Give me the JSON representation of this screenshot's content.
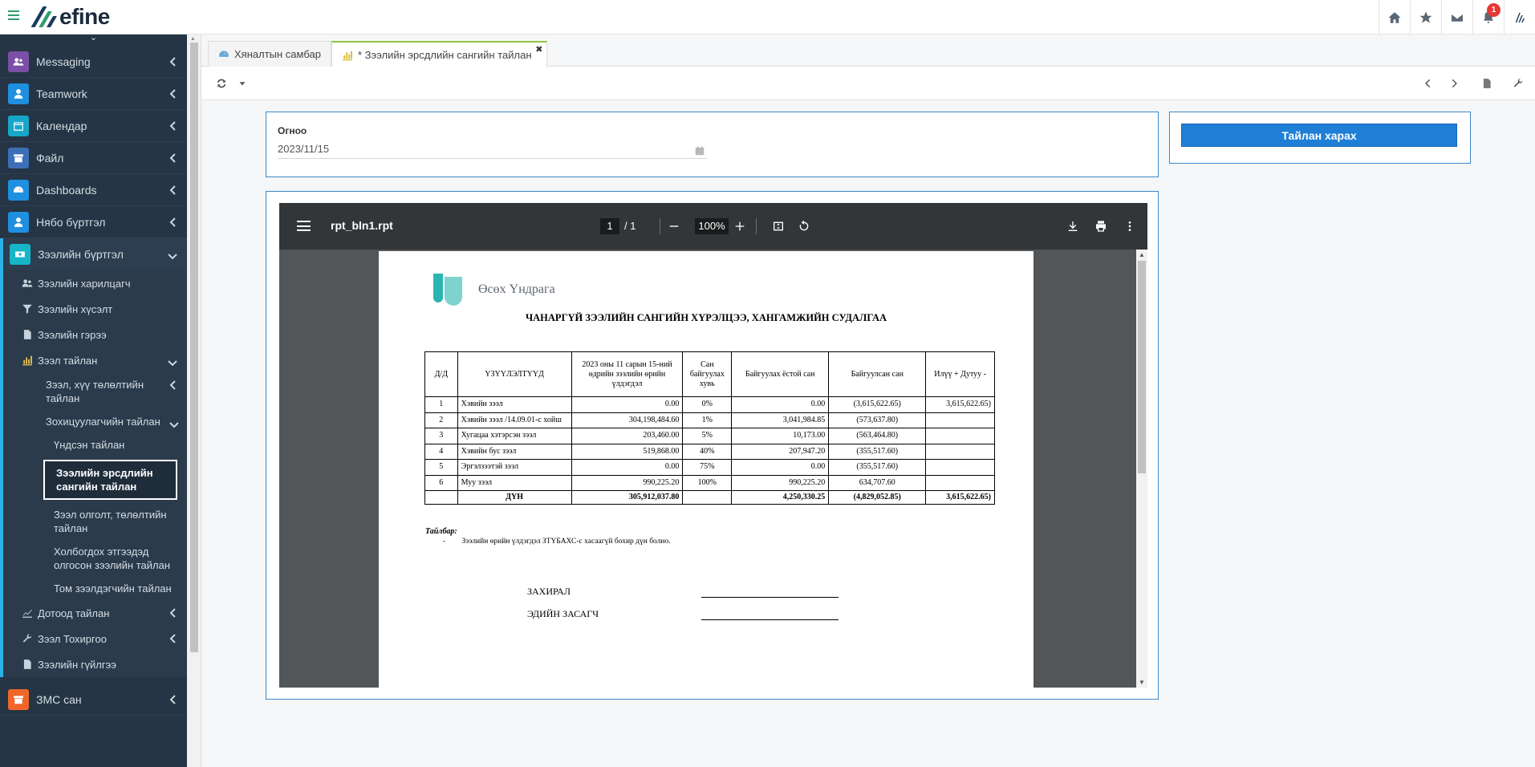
{
  "app": {
    "logo_text": "efine",
    "notification_count": "1"
  },
  "sidebar": {
    "items": [
      {
        "label": "Messaging",
        "color": "#7b4fa8"
      },
      {
        "label": "Teamwork",
        "color": "#1f8fe0"
      },
      {
        "label": "Календар",
        "color": "#17a6c9"
      },
      {
        "label": "Файл",
        "color": "#3c6fb8"
      },
      {
        "label": "Dashboards",
        "color": "#1f8fe0"
      },
      {
        "label": "Нябо бүртгэл",
        "color": "#1f8fe0"
      }
    ],
    "open_section": {
      "label": "Зээлийн бүртгэл",
      "color": "#17b5c8"
    },
    "subitems": [
      {
        "label": "Зээлийн харилцагч"
      },
      {
        "label": "Зээлийн хүсэлт"
      },
      {
        "label": "Зээлийн гэрээ"
      },
      {
        "label": "Зээл тайлан"
      }
    ],
    "report_children": [
      {
        "label": "Зээл, хүү төлөлтийн тайлан"
      },
      {
        "label": "Зохицуулагчийн тайлан"
      }
    ],
    "regulator_children": [
      {
        "label": "Үндсэн тайлан"
      },
      {
        "label": "Зээлийн эрсдлийн сангийн тайлан"
      },
      {
        "label": "Зээл олголт, төлөлтийн тайлан"
      },
      {
        "label": "Холбогдох этгээдэд олгосон зээлийн тайлан"
      },
      {
        "label": "Том зээлдэгчийн тайлан"
      }
    ],
    "after_items": [
      {
        "label": "Дотоод тайлан"
      },
      {
        "label": "Зээл Тохиргоо"
      },
      {
        "label": "Зээлийн гүйлгээ"
      }
    ],
    "bottom_item": {
      "label": "ЗМС сан",
      "color": "#f0662a"
    }
  },
  "tabs": [
    {
      "label": "Хяналтын самбар"
    },
    {
      "label": "* Зээлийн эрсдлийн сангийн тайлан"
    }
  ],
  "form": {
    "date_label": "Огноо",
    "date_value": "2023/11/15",
    "submit_label": "Тайлан харах"
  },
  "pdf": {
    "file_name": "rpt_bln1.rpt",
    "page_current": "1",
    "page_total": "/ 1",
    "zoom": "100%"
  },
  "report": {
    "org_name": "Өсөх Үндрага",
    "heading": "ЧАНАРГҮЙ ЗЭЭЛИЙН САНГИЙН ХҮРЭЛЦЭЭ, ХАНГАМЖИЙН СУДАЛГАА",
    "columns": [
      "Д/Д",
      "ҮЗҮҮЛЭЛТҮҮД",
      "2023 оны 11 сарын 15-ний өдрийн зээлийн өрийн үлдэгдэл",
      "Сан байгуулах хувь",
      "Байгуулах ёстой сан",
      "Байгуулсан сан",
      "Илүү + Дутуу -"
    ],
    "rows": [
      [
        "1",
        "Хэвийн зээл",
        "0.00",
        "0%",
        "0.00",
        "(3,615,622.65)",
        "3,615,622.65)"
      ],
      [
        "2",
        "Хэвийн зээл /14.09.01-с хойш",
        "304,198,484.60",
        "1%",
        "3,041,984.85",
        "(573,637.80)",
        ""
      ],
      [
        "3",
        "Хугацаа хэтэрсэн зээл",
        "203,460.00",
        "5%",
        "10,173.00",
        "(563,464.80)",
        ""
      ],
      [
        "4",
        "Хэвийн бус зээл",
        "519,868.00",
        "40%",
        "207,947.20",
        "(355,517.60)",
        ""
      ],
      [
        "5",
        "Эргэлзээтэй зээл",
        "0.00",
        "75%",
        "0.00",
        "(355,517.60)",
        ""
      ],
      [
        "6",
        "Муу зээл",
        "990,225.20",
        "100%",
        "990,225.20",
        "634,707.60",
        ""
      ]
    ],
    "total": [
      "",
      "ДҮН",
      "305,912,037.80",
      "",
      "4,250,330.25",
      "(4,829,052.85)",
      "3,615,622.65)"
    ],
    "note_title": "Тайлбар:",
    "note_dash": "-",
    "note_text": "Зээлийн өрийн үлдэгдэл ЗТҮБАХС-с хасаагүй бохир дүн болно.",
    "sig_director": "ЗАХИРАЛ",
    "sig_accountant": "ЭДИЙН ЗАСАГЧ"
  }
}
